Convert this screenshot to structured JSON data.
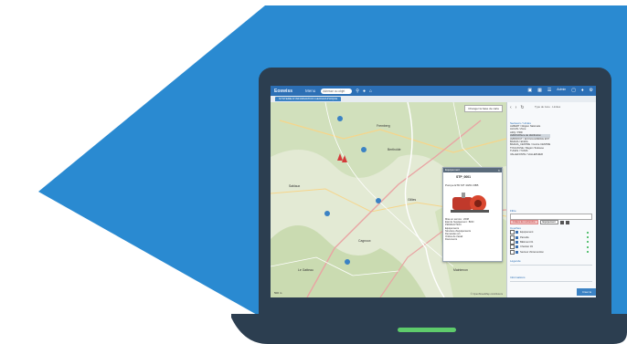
{
  "colors": {
    "brand_blue": "#2a8ad1",
    "laptop_body": "#2c3e50",
    "trackpad_green": "#5ecb6b",
    "app_header": "#2c6fb5"
  },
  "app": {
    "brand": "Eoswiss",
    "menu_label": "Menu",
    "search_placeholder": "Adresse ou objet",
    "tab_label": "SYSTEME D'INFORMATION GEOGRAPHIQUE",
    "user_label": "Admin"
  },
  "map": {
    "view_button": "Changer la base de carte",
    "towns": [
      "Fremberg",
      "Bertholde",
      "Gillies",
      "Cagnoux",
      "Le Gatteau",
      "Maintenon",
      "Sablaux"
    ],
    "scale_text": "500 m",
    "copyright": "© OpenStreetMap contributors"
  },
  "popup": {
    "header": "Equipement",
    "equipment_id": "STP_0001",
    "code": "Pompe ETD MT 40/01 RB5",
    "lines": [
      "Mise en service : 2008",
      "Etat de l'équipement : BON",
      "PRODUCTION",
      "Equipements",
      "Structure d'équipements",
      "Demandes (2)",
      "Ordres de travail",
      "Documents"
    ]
  },
  "sidebar": {
    "mini_label": "Type de zone · Limites",
    "list_title": "Secteurs / Unités",
    "list_items": [
      "ALBERT / Région Nationale",
      "ALCAN / Zone",
      "ARQ / PRD",
      "AVENS/Pièce de distribution",
      "AVRIDOUT / ECOLIA AVENUE EST",
      "BAZAIA / ENAIA",
      "BAZAIA_CENTRE / Centre CENTRE",
      "TOULOUSE / Région Toulouse",
      "TUNAS / TUNIS",
      "VALLEFONTE / VALLEPHIER"
    ],
    "selected_index": 3,
    "filter_label": "Filtre",
    "filter_tag": "Critère de recherche",
    "filter_type": "Equipement",
    "layers_label": "Couches",
    "layers": [
      "Equipement",
      "Parcelle",
      "Bâtiment 01",
      "Chantier 03",
      "Secteur d'intervention"
    ],
    "section_one": "Légende",
    "section_two": "Informations",
    "footer_button": "Créer la demande"
  }
}
